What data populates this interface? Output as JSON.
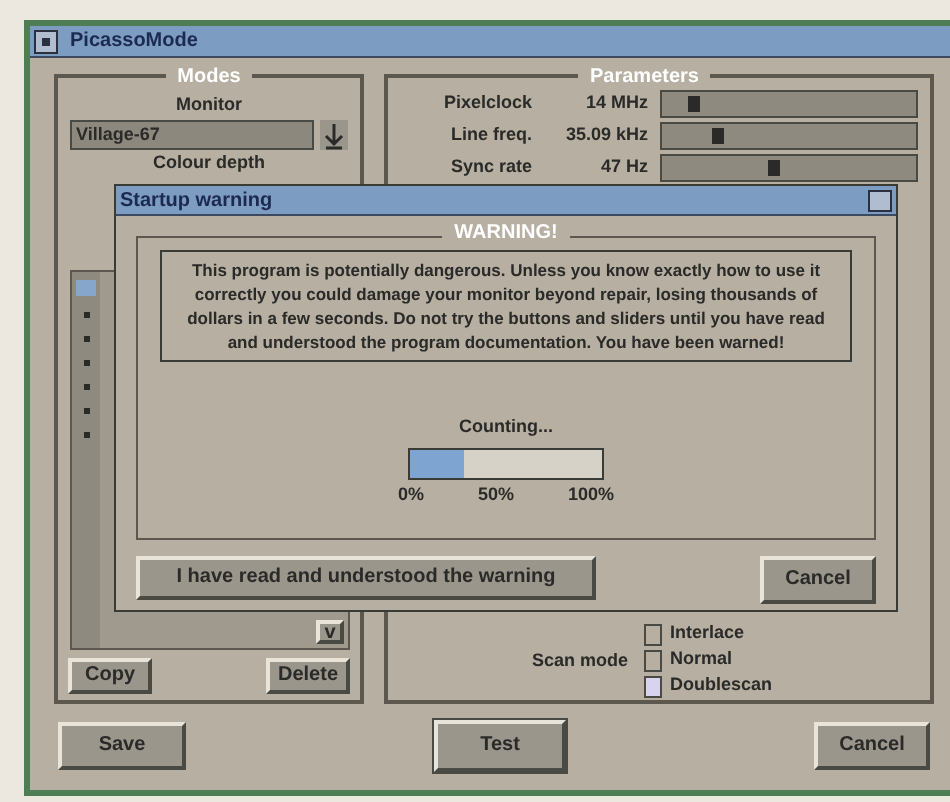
{
  "window": {
    "title": "PicassoMode"
  },
  "modes": {
    "title": "Modes",
    "monitor_label": "Monitor",
    "monitor_value": "Village-67",
    "colour_depth_label": "Colour depth",
    "scroll_arrow": "v",
    "buttons": [
      "Copy",
      "Delete"
    ]
  },
  "parameters": {
    "title": "Parameters",
    "rows": [
      {
        "label": "Pixelclock",
        "reading": "14 MHz",
        "level": 0.1
      },
      {
        "label": "Line freq.",
        "reading": "35.09 kHz",
        "level": 0.2
      },
      {
        "label": "Sync rate",
        "reading": "47 Hz",
        "level": 0.42
      }
    ],
    "scan_mode": {
      "label": "Scan mode",
      "options": [
        {
          "label": "Interlace",
          "checked": false
        },
        {
          "label": "Normal",
          "checked": false
        },
        {
          "label": "Doublescan",
          "checked": true
        }
      ]
    }
  },
  "buttons": [
    "Save",
    "Test",
    "Cancel"
  ],
  "dialog": {
    "title": "Startup warning",
    "group_title": "WARNING!",
    "message": "This program is potentially dangerous. Unless you know exactly how to use it correctly you could damage your monitor beyond repair, losing thousands of dollars in a few seconds. Do not try the buttons and sliders until you have read and understood the program documentation. You have been warned!",
    "counting": "Counting...",
    "progress": {
      "level": 0.28
    },
    "scale": [
      "0%",
      "50%",
      "100%"
    ],
    "buttons": [
      "I have read and understood the warning",
      "Cancel"
    ]
  }
}
